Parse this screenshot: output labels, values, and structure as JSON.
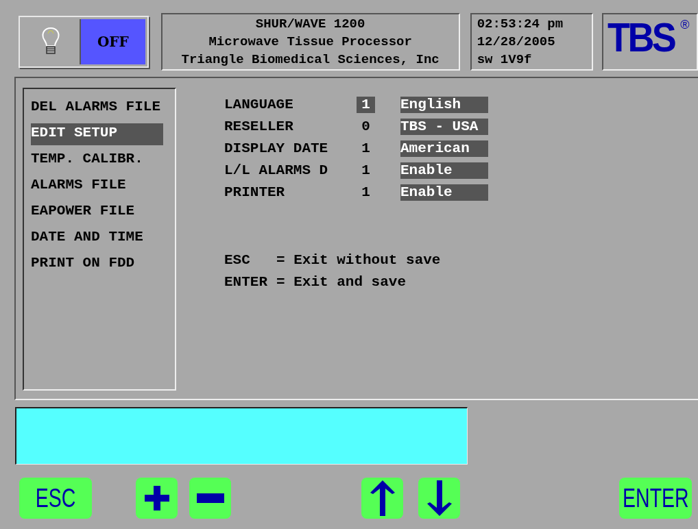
{
  "power": {
    "label": "OFF",
    "on": false
  },
  "title_lines": [
    "SHUR/WAVE 1200",
    "Microwave Tissue Processor",
    "Triangle Biomedical Sciences, Inc"
  ],
  "status_lines": [
    "02:53:24 pm",
    "12/28/2005",
    "sw 1V9f"
  ],
  "logo": {
    "text": "TBS",
    "mark": "®"
  },
  "menu": [
    {
      "label": "DEL ALARMS FILE",
      "selected": false
    },
    {
      "label": "EDIT SETUP",
      "selected": true
    },
    {
      "label": "TEMP. CALIBR.",
      "selected": false
    },
    {
      "label": "ALARMS FILE",
      "selected": false
    },
    {
      "label": "EAPOWER FILE",
      "selected": false
    },
    {
      "label": "DATE AND TIME",
      "selected": false
    },
    {
      "label": "PRINT ON FDD",
      "selected": false
    }
  ],
  "settings": [
    {
      "label": "LANGUAGE",
      "code": "1",
      "value": "English",
      "selected": true
    },
    {
      "label": "RESELLER",
      "code": "0",
      "value": "TBS - USA",
      "selected": false
    },
    {
      "label": "DISPLAY DATE",
      "code": "1",
      "value": "American",
      "selected": false
    },
    {
      "label": "L/L ALARMS D",
      "code": "1",
      "value": "Enable",
      "selected": false
    },
    {
      "label": "PRINTER",
      "code": "1",
      "value": "Enable",
      "selected": false
    }
  ],
  "legend": [
    {
      "key": "ESC",
      "text": "= Exit without save"
    },
    {
      "key": "ENTER",
      "text": "= Exit and save"
    }
  ],
  "buttons": [
    {
      "kind": "text",
      "label": "ESC"
    },
    {
      "kind": "plus"
    },
    {
      "kind": "minus"
    },
    {
      "kind": "up"
    },
    {
      "kind": "down"
    },
    {
      "kind": "text",
      "label": "ENTER"
    }
  ]
}
